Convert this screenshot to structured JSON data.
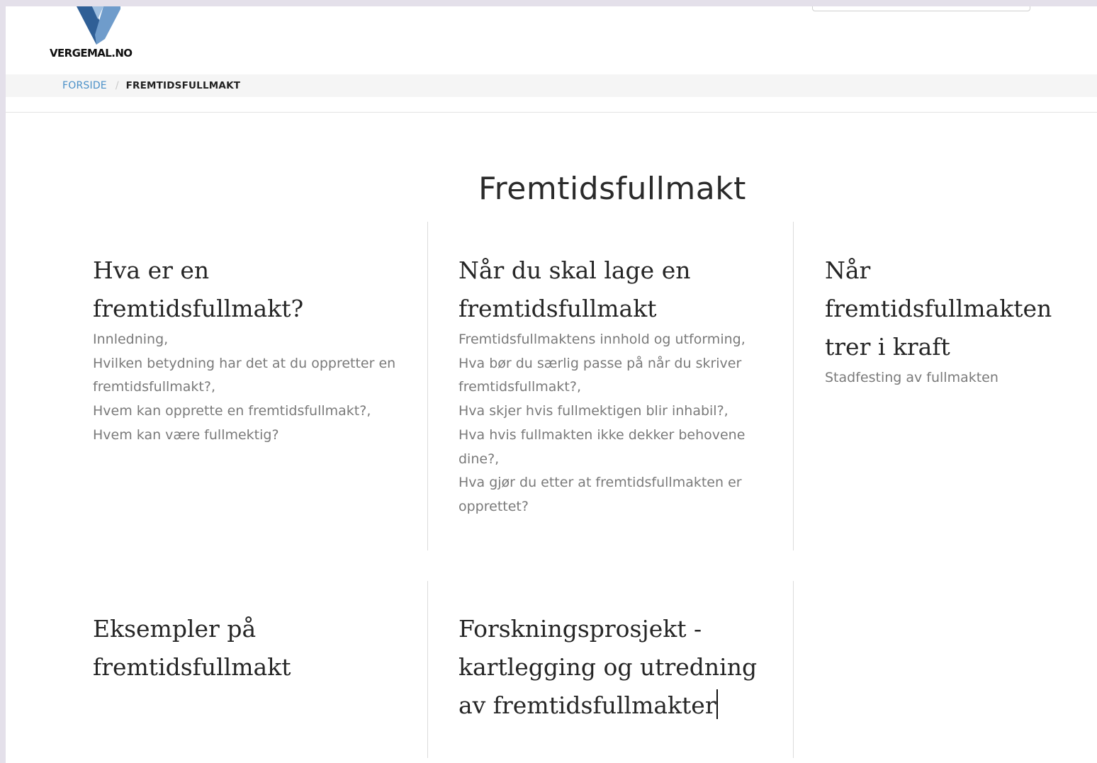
{
  "header": {
    "logo_text": "VERGEMAL.NO",
    "logo_colors": [
      "#2f5f96",
      "#4a7ab0",
      "#7fa7d0"
    ]
  },
  "breadcrumb": {
    "home": "FORSIDE",
    "separator": "/",
    "current": "FREMTIDSFULLMAKT"
  },
  "main": {
    "title": "Fremtidsfullmakt",
    "cards": [
      {
        "title": "Hva er en fremtidsfullmakt?",
        "links": [
          "Innledning,",
          "Hvilken betydning har det at du oppretter en fremtidsfullmakt?,",
          "Hvem kan opprette en fremtidsfullmakt?,",
          "Hvem kan være fullmektig?"
        ]
      },
      {
        "title": "Når du skal lage en fremtidsfullmakt",
        "links": [
          "Fremtidsfullmaktens innhold og utforming,",
          "Hva bør du særlig passe på når du skriver fremtidsfullmakt?,",
          "Hva skjer hvis fullmektigen blir inhabil?,",
          "Hva hvis fullmakten ikke dekker behovene dine?,",
          "Hva gjør du etter at fremtidsfullmakten er opprettet?"
        ]
      },
      {
        "title": "Når fremtidsfullmakten trer i kraft",
        "links": [
          "Stadfesting av fullmakten"
        ]
      },
      {
        "title": "Eksempler på fremtidsfullmakt",
        "links": []
      },
      {
        "title": "Forskningsprosjekt - kartlegging og utredning av fremtidsfullmakter",
        "links": []
      }
    ]
  }
}
